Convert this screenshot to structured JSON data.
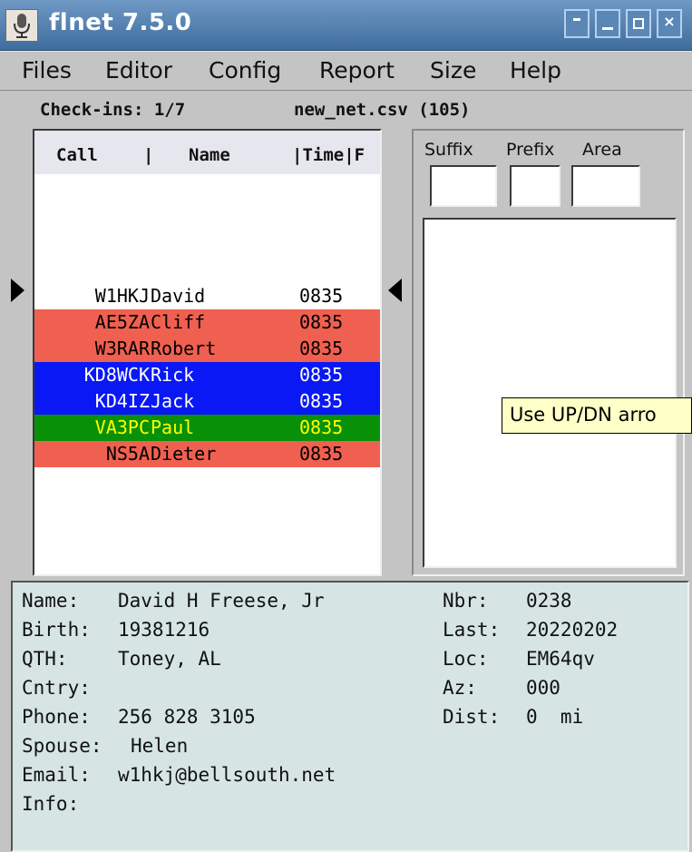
{
  "window": {
    "title": "flnet 7.5.0",
    "icon": "microphone-icon",
    "buttons": [
      "menu",
      "minimize",
      "maximize",
      "close"
    ]
  },
  "menu": {
    "files": "Files",
    "editor": "Editor",
    "config": "Config",
    "report": "Report",
    "size": "Size",
    "help": "Help"
  },
  "status": {
    "checkins": "Check-ins: 1/7",
    "file": "new_net.csv (105)"
  },
  "list": {
    "headers": {
      "call": "Call",
      "sep1": "|",
      "name": "Name",
      "time": "|Time|F"
    },
    "rows": [
      {
        "call": "W1HKJ",
        "name": "David",
        "time": "0835",
        "bg": "#ffffff",
        "fg": "#000000"
      },
      {
        "call": "AE5ZA",
        "name": "Cliff",
        "time": "0835",
        "bg": "#f06050",
        "fg": "#000000"
      },
      {
        "call": "W3RAR",
        "name": "Robert",
        "time": "0835",
        "bg": "#f06050",
        "fg": "#000000"
      },
      {
        "call": "KD8WCK",
        "name": "Rick",
        "time": "0835",
        "bg": "#0a18f5",
        "fg": "#ffffff"
      },
      {
        "call": "KD4IZ",
        "name": "Jack",
        "time": "0835",
        "bg": "#0a18f5",
        "fg": "#ffffff"
      },
      {
        "call": "VA3PC",
        "name": "Paul",
        "time": "0835",
        "bg": "#089008",
        "fg": "#ffff00"
      },
      {
        "call": "NS5A",
        "name": "Dieter",
        "time": "0835",
        "bg": "#f06050",
        "fg": "#000000"
      }
    ]
  },
  "search": {
    "suffix_label": "Suffix",
    "prefix_label": "Prefix",
    "area_label": "Area",
    "suffix_value": "",
    "prefix_value": "",
    "area_value": ""
  },
  "tooltip": "Use UP/DN arro",
  "details": {
    "name_label": "Name:",
    "name": "David H Freese, Jr",
    "birth_label": "Birth:",
    "birth": "19381216",
    "qth_label": "QTH:",
    "qth": "Toney, AL",
    "cntry_label": "Cntry:",
    "cntry": "",
    "phone_label": "Phone:",
    "phone": "256 828 3105",
    "spouse_label": "Spouse:",
    "spouse": "Helen",
    "email_label": "Email:",
    "email": "w1hkj@bellsouth.net",
    "info_label": "Info:",
    "info": "",
    "nbr_label": "Nbr:",
    "nbr": "0238",
    "last_label": "Last:",
    "last": "20220202",
    "loc_label": "Loc:",
    "loc": "EM64qv",
    "az_label": "Az:",
    "az": "000",
    "dist_label": "Dist:",
    "dist": "0  mi"
  }
}
